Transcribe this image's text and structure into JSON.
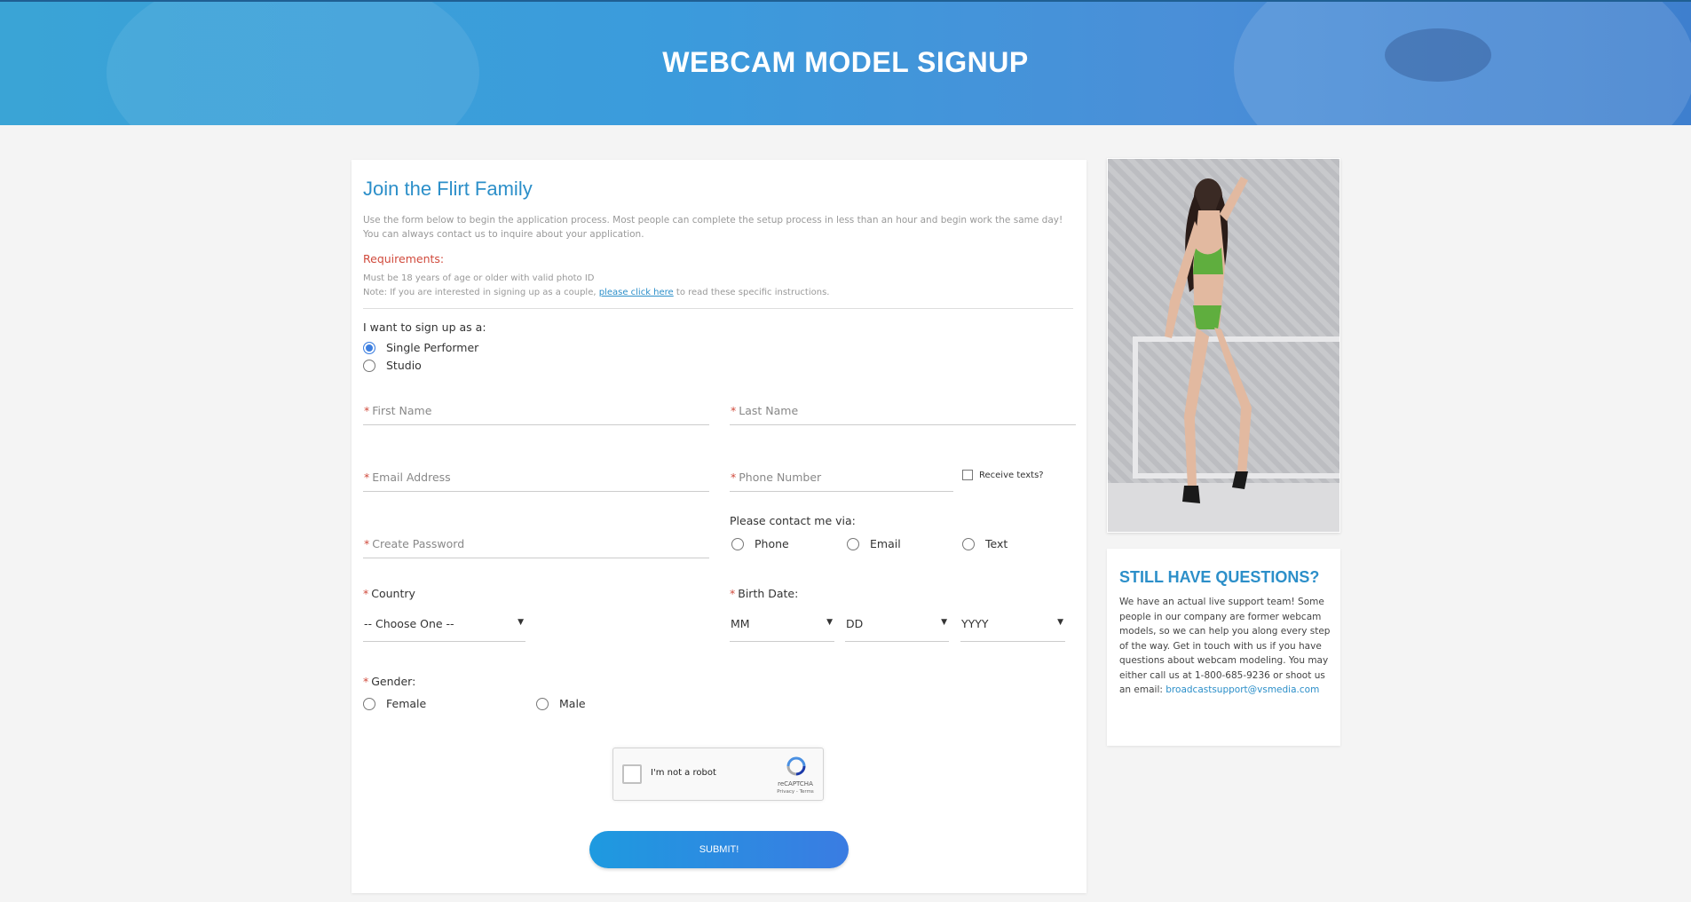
{
  "header": {
    "title": "WEBCAM MODEL SIGNUP"
  },
  "form": {
    "title": "Join the Flirt Family",
    "intro": "Use the form below to begin the application process. Most people can complete the setup process in less than an hour and begin work the same day! You can always contact us to inquire about your application.",
    "requirements_title": "Requirements:",
    "requirement_1": "Must be 18 years of age or older with valid photo ID",
    "note_prefix": "Note: If you are interested in signing up as a couple, ",
    "note_link": "please click here",
    "note_suffix": " to read these specific instructions.",
    "signup_as_label": "I want to sign up as a:",
    "signup_options": [
      {
        "label": "Single Performer",
        "checked": true
      },
      {
        "label": "Studio",
        "checked": false
      }
    ],
    "required_marker": "*",
    "first_name_label": "First Name",
    "last_name_label": "Last Name",
    "email_label": "Email Address",
    "phone_label": "Phone Number",
    "receive_texts_label": "Receive texts?",
    "contact_via_label": "Please contact me via:",
    "contact_options": [
      "Phone",
      "Email",
      "Text"
    ],
    "password_label": "Create Password",
    "country_label": "Country",
    "country_value": "-- Choose One --",
    "birth_date_label": "Birth Date:",
    "birth_month": "MM",
    "birth_day": "DD",
    "birth_year": "YYYY",
    "gender_label": "Gender:",
    "gender_options": [
      "Female",
      "Male"
    ],
    "captcha_text": "I'm not a robot",
    "captcha_brand": "reCAPTCHA",
    "captcha_terms": "Privacy - Terms",
    "submit_label": "SUBMIT!"
  },
  "sidebar": {
    "questions_title": "STILL HAVE QUESTIONS?",
    "questions_body": "We have an actual live support team! Some people in our company are former webcam models, so we can help you along every step of the way. Get in touch with us if you have questions about webcam modeling. You may either call us at 1-800-685-9236 or shoot us an email: ",
    "support_email": "broadcastsupport@vsmedia.com"
  },
  "colors": {
    "accent": "#2c8fc9",
    "required": "#d04a3c",
    "radio_checked": "#3d7fe0"
  }
}
